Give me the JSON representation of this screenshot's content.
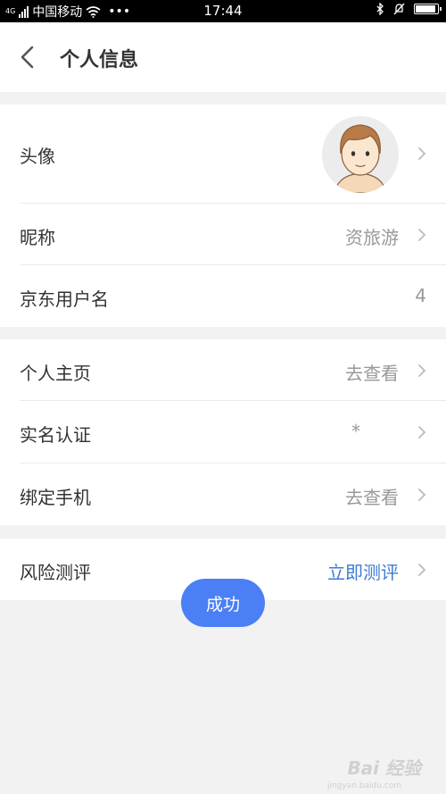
{
  "status_bar": {
    "network": "4G",
    "carrier": "中国移动",
    "more": "•••",
    "time": "17:44"
  },
  "header": {
    "title": "个人信息"
  },
  "groups": [
    {
      "rows": [
        {
          "label": "头像",
          "value": ""
        },
        {
          "label": "昵称",
          "value": "资旅游"
        },
        {
          "label": "京东用户名",
          "value": "4"
        }
      ]
    },
    {
      "rows": [
        {
          "label": "个人主页",
          "value": "去查看"
        },
        {
          "label": "实名认证",
          "value": "*"
        },
        {
          "label": "绑定手机",
          "value": "去查看"
        }
      ]
    },
    {
      "rows": [
        {
          "label": "风险测评",
          "value": "立即测评"
        }
      ]
    }
  ],
  "toast": {
    "text": "成功"
  },
  "watermark": {
    "text": "Bai 经验",
    "sub": "jingyan.baidu.com"
  },
  "colors": {
    "accent": "#3c7bd6",
    "toast": "#4a7ff5",
    "background": "#f2f2f2"
  }
}
